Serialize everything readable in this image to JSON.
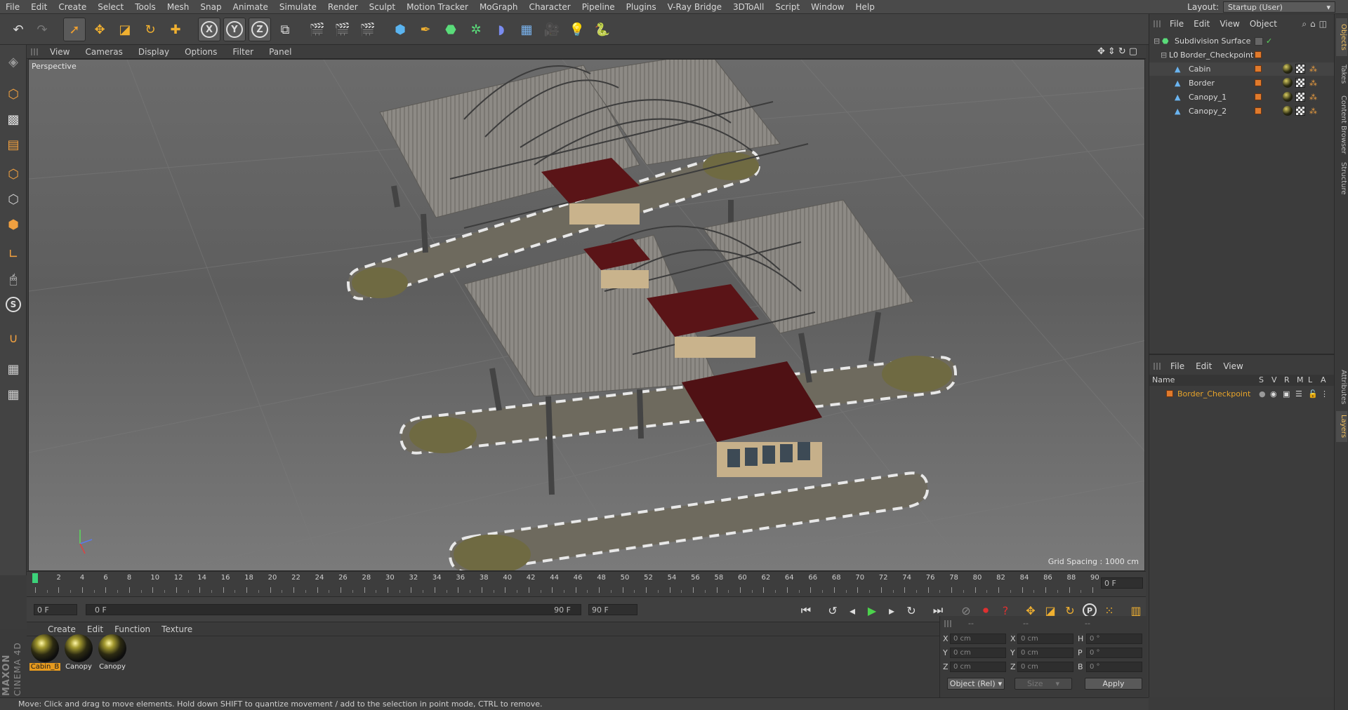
{
  "menubar": {
    "items": [
      "File",
      "Edit",
      "Create",
      "Select",
      "Tools",
      "Mesh",
      "Snap",
      "Animate",
      "Simulate",
      "Render",
      "Sculpt",
      "Motion Tracker",
      "MoGraph",
      "Character",
      "Pipeline",
      "Plugins",
      "V-Ray Bridge",
      "3DToAll",
      "Script",
      "Window",
      "Help"
    ],
    "layout_label": "Layout:",
    "layout_value": "Startup (User)"
  },
  "toolbar": {
    "axis_x": "X",
    "axis_y": "Y",
    "axis_z": "Z"
  },
  "viewport": {
    "menu": [
      "View",
      "Cameras",
      "Display",
      "Options",
      "Filter",
      "Panel"
    ],
    "label": "Perspective",
    "grid_spacing": "Grid Spacing : 1000 cm"
  },
  "timeline": {
    "ticks": [
      "0",
      "2",
      "4",
      "6",
      "8",
      "10",
      "12",
      "14",
      "16",
      "18",
      "20",
      "22",
      "24",
      "26",
      "28",
      "30",
      "32",
      "34",
      "36",
      "38",
      "40",
      "42",
      "44",
      "46",
      "48",
      "50",
      "52",
      "54",
      "56",
      "58",
      "60",
      "62",
      "64",
      "66",
      "68",
      "70",
      "72",
      "74",
      "76",
      "78",
      "80",
      "82",
      "84",
      "86",
      "88",
      "90"
    ],
    "current_frame": "0 F"
  },
  "playbar": {
    "start": "0 F",
    "range_start": "0 F",
    "range_end": "90 F",
    "end": "90 F"
  },
  "materials": {
    "menu": [
      "Create",
      "Edit",
      "Function",
      "Texture"
    ],
    "items": [
      {
        "label": "Cabin_B",
        "selected": true
      },
      {
        "label": "Canopy",
        "selected": false
      },
      {
        "label": "Canopy",
        "selected": false
      }
    ]
  },
  "coords": {
    "headers": [
      "--",
      "--",
      "--"
    ],
    "rows": [
      {
        "a": "X",
        "av": "0 cm",
        "b": "X",
        "bv": "0 cm",
        "c": "H",
        "cv": "0 °"
      },
      {
        "a": "Y",
        "av": "0 cm",
        "b": "Y",
        "bv": "0 cm",
        "c": "P",
        "cv": "0 °"
      },
      {
        "a": "Z",
        "av": "0 cm",
        "b": "Z",
        "bv": "0 cm",
        "c": "B",
        "cv": "0 °"
      }
    ],
    "mode": "Object (Rel)",
    "size": "Size",
    "apply": "Apply"
  },
  "object_manager": {
    "menu": [
      "File",
      "Edit",
      "View",
      "Object"
    ],
    "objects": [
      {
        "name": "Subdivision Surface"
      },
      {
        "name": "Border_Checkpoint"
      },
      {
        "name": "Cabin"
      },
      {
        "name": "Border"
      },
      {
        "name": "Canopy_1"
      },
      {
        "name": "Canopy_2"
      }
    ]
  },
  "layer_manager": {
    "menu": [
      "File",
      "Edit",
      "View"
    ],
    "header_name": "Name",
    "cols": [
      "S",
      "V",
      "R",
      "M",
      "L",
      "A"
    ],
    "layers": [
      {
        "name": "Border_Checkpoint",
        "color": "#e8a42a"
      }
    ]
  },
  "right_tabs": [
    "Objects",
    "Takes",
    "Content Browser",
    "Structure",
    "Attributes",
    "Layers"
  ],
  "branding": {
    "maxon": "MAXON",
    "product": "CINEMA 4D"
  },
  "status": "Move: Click and drag to move elements. Hold down SHIFT to quantize movement / add to the selection in point mode, CTRL to remove.",
  "colors": {
    "accent": "#e79a1e",
    "object_orange": "#e07a2c",
    "viewport_bg": "#666666"
  }
}
